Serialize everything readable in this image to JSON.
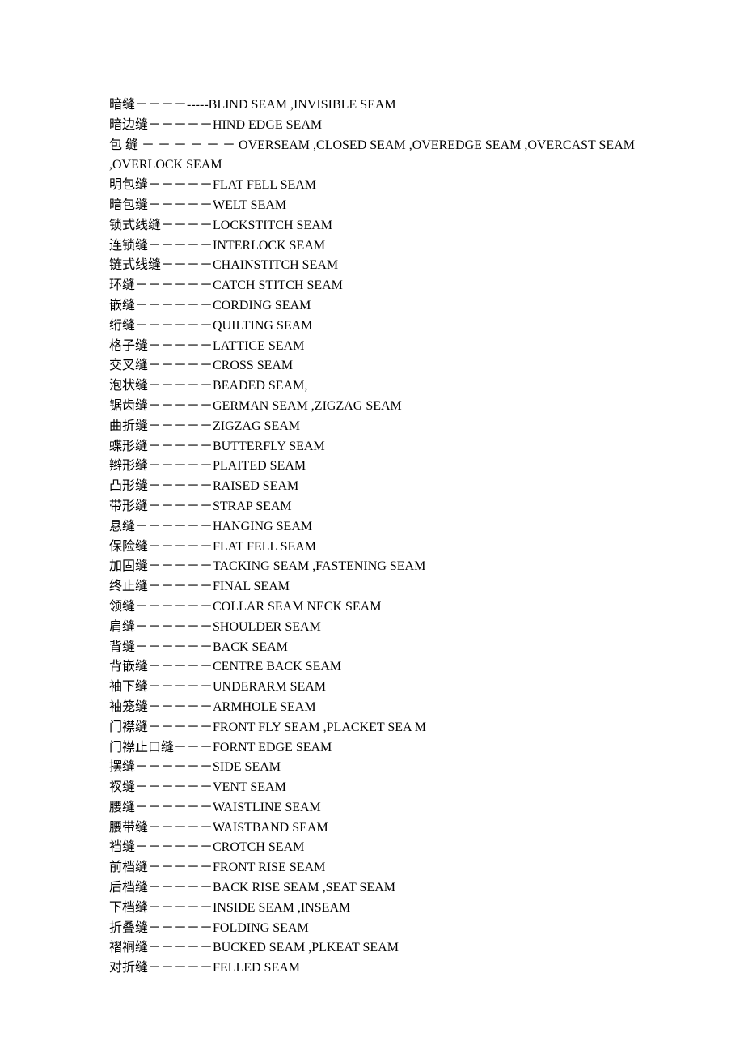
{
  "lines": [
    "暗缝－－－－-----BLIND SEAM ,INVISIBLE SEAM",
    "暗边缝－－－－－HIND EDGE SEAM",
    "包 缝 － － － － － － OVERSEAM ,CLOSED SEAM ,OVEREDGE SEAM ,OVERCAST SEAM ,OVERLOCK SEAM",
    "明包缝－－－－－FLAT FELL SEAM",
    "暗包缝－－－－－WELT SEAM",
    "锁式线缝－－－－LOCKSTITCH SEAM",
    "连锁缝－－－－－INTERLOCK SEAM",
    "链式线缝－－－－CHAINSTITCH SEAM",
    "环缝－－－－－－CATCH STITCH SEAM",
    "嵌缝－－－－－－CORDING SEAM",
    "绗缝－－－－－－QUILTING SEAM",
    "格子缝－－－－－LATTICE SEAM",
    "交叉缝－－－－－CROSS SEAM",
    "泡状缝－－－－－BEADED SEAM,",
    "锯齿缝－－－－－GERMAN SEAM ,ZIGZAG SEAM",
    "曲折缝－－－－－ZIGZAG SEAM",
    "蝶形缝－－－－－BUTTERFLY SEAM",
    "辫形缝－－－－－PLAITED SEAM",
    "凸形缝－－－－－RAISED SEAM",
    "带形缝－－－－－STRAP SEAM",
    "悬缝－－－－－－HANGING SEAM",
    "保险缝－－－－－FLAT FELL SEAM",
    "加固缝－－－－－TACKING SEAM ,FASTENING SEAM",
    "终止缝－－－－－FINAL SEAM",
    "领缝－－－－－－COLLAR SEAM NECK SEAM",
    "肩缝－－－－－－SHOULDER SEAM",
    "背缝－－－－－－BACK SEAM",
    "背嵌缝－－－－－CENTRE BACK SEAM",
    "袖下缝－－－－－UNDERARM SEAM",
    "袖笼缝－－－－－ARMHOLE SEAM",
    "门襟缝－－－－－FRONT FLY SEAM ,PLACKET SEA M",
    "门襟止口缝－－－FORNT EDGE SEAM",
    "摆缝－－－－－－SIDE SEAM",
    "衩缝－－－－－－VENT SEAM",
    "腰缝－－－－－－WAISTLINE SEAM",
    "腰带缝－－－－－WAISTBAND SEAM",
    "裆缝－－－－－－CROTCH SEAM",
    "前档缝－－－－－FRONT RISE SEAM",
    "后档缝－－－－－BACK RISE SEAM ,SEAT SEAM",
    "下档缝－－－－－INSIDE SEAM ,INSEAM",
    "折叠缝－－－－－FOLDING SEAM",
    "褶裥缝－－－－－BUCKED SEAM ,PLKEAT SEAM",
    "对折缝－－－－－FELLED SEAM"
  ]
}
